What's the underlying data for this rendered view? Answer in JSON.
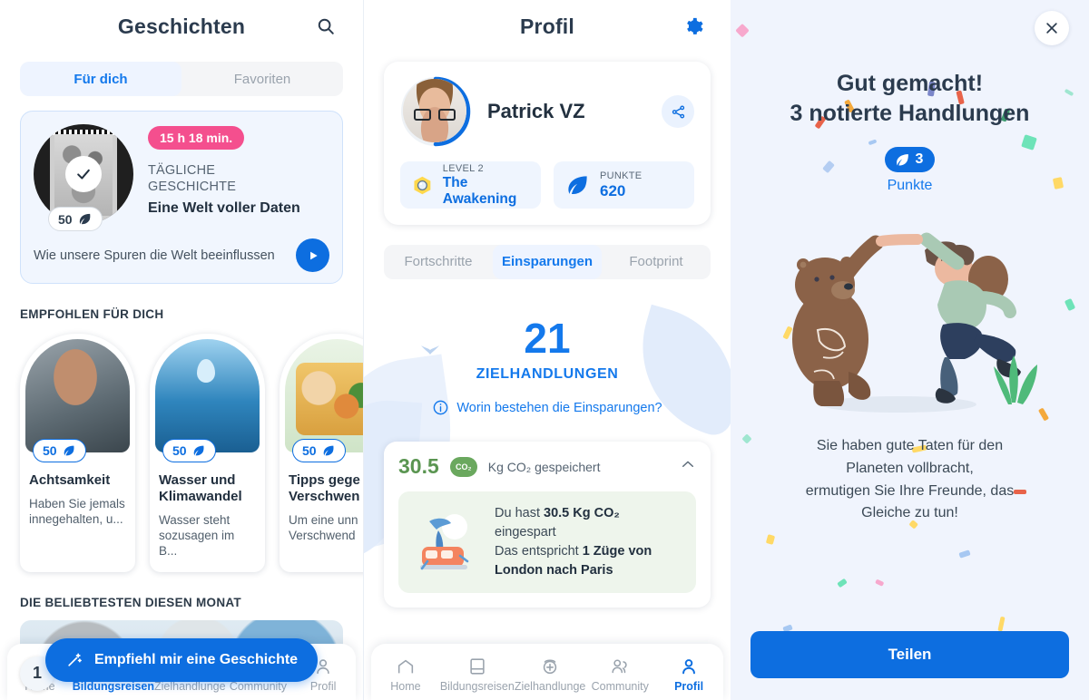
{
  "stories": {
    "header": {
      "title": "Geschichten",
      "search_icon": "search-icon"
    },
    "tabs": [
      {
        "label": "Für dich",
        "active": true
      },
      {
        "label": "Favoriten",
        "active": false
      }
    ],
    "daily_story": {
      "time_badge": "15 h 18 min.",
      "kicker_line1": "TÄGLICHE",
      "kicker_line2": "GESCHICHTE",
      "title": "Eine Welt voller Daten",
      "subtitle": "Wie unsere Spuren die Welt beeinflussen",
      "points": "50",
      "points_icon": "leaf-icon",
      "completed_icon": "check-icon",
      "play_icon": "play-icon"
    },
    "recommended_heading": "EMPFOHLEN FÜR DICH",
    "recommended": [
      {
        "points": "50",
        "title": "Achtsamkeit",
        "desc": "Haben Sie jemals innegehalten, u..."
      },
      {
        "points": "50",
        "title": "Wasser und Klimawandel",
        "desc": "Wasser steht sozusagen im B..."
      },
      {
        "points": "50",
        "title": "Tipps gege Verschwen",
        "desc": "Um eine unn Verschwend"
      }
    ],
    "popular_heading": "DIE BELIEBTESTEN DIESEN MONAT",
    "popular_rank": "1",
    "cta": {
      "label": "Empfiehl mir eine Geschichte",
      "icon": "magic-wand-icon"
    }
  },
  "profile": {
    "header": {
      "title": "Profil",
      "settings_icon": "gear-icon"
    },
    "user": {
      "name": "Patrick VZ",
      "avatar": "user-avatar",
      "share_icon": "share-icon"
    },
    "level": {
      "label": "LEVEL 2",
      "value": "The Awakening",
      "icon": "level-badge-icon"
    },
    "points": {
      "label": "PUNKTE",
      "value": "620",
      "icon": "leaf-icon"
    },
    "tabs": [
      {
        "label": "Fortschritte",
        "active": false
      },
      {
        "label": "Einsparungen",
        "active": true
      },
      {
        "label": "Footprint",
        "active": false
      }
    ],
    "savings": {
      "value": "21",
      "caption": "ZIELHANDLUNGEN",
      "info_link": "Worin bestehen die Einsparungen?",
      "info_icon": "info-icon"
    },
    "co2": {
      "value": "30.5",
      "chip": "CO₂",
      "unit_text": "Kg CO₂ gespeichert",
      "collapse_icon": "chevron-up-icon",
      "detail_line1_pre": "Du hast ",
      "detail_line1_bold": "30.5 Kg CO₂",
      "detail_line1_post": " eingespart",
      "detail_line2_pre": "Das entspricht ",
      "detail_line2_bold": "1 Züge von London nach Paris",
      "illustration": "train-illustration"
    }
  },
  "celebration": {
    "close_icon": "close-icon",
    "title_line1": "Gut gemacht!",
    "title_line2": "3 notierte Handlungen",
    "badge_value": "3",
    "badge_icon": "leaf-icon",
    "badge_label": "Punkte",
    "illustration": "bear-and-person-high-five-illustration",
    "body_line1": "Sie haben gute Taten für den",
    "body_line2": "Planeten vollbracht,",
    "body_line3": "ermutigen Sie Ihre Freunde, das",
    "body_line4": "Gleiche zu tun!",
    "share_button": "Teilen"
  },
  "tabbar": [
    {
      "label": "Home",
      "icon": "home-icon"
    },
    {
      "label": "Bildungsreisen",
      "icon": "book-icon"
    },
    {
      "label": "Zielhandlunge",
      "icon": "target-plus-icon"
    },
    {
      "label": "Community",
      "icon": "people-icon"
    },
    {
      "label": "Profil",
      "icon": "person-icon"
    }
  ],
  "tabbar_active_left": "Bildungsreisen",
  "tabbar_active_mid": "Profil",
  "colors": {
    "accent_blue": "#0d6ee0",
    "link_blue": "#1479ec",
    "pink_badge": "#f44f8e",
    "green_co2": "#5a9551",
    "text_dark": "#22303f",
    "muted": "#9aa3ad",
    "panel_tint": "#f0f4fd"
  }
}
